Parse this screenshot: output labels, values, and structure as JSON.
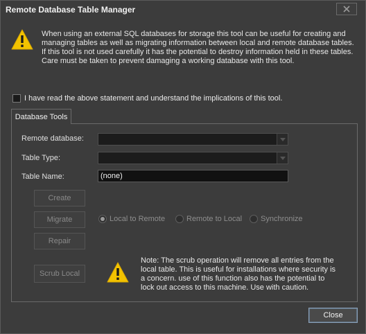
{
  "window": {
    "title": "Remote Database Table Manager",
    "close_icon": "close-icon"
  },
  "warning": {
    "text": [
      "When using an external SQL databases for storage this tool can be useful for creating and",
      "managing tables as well as migrating information between local and remote database tables.",
      "If this tool is not used carefully it has the potential to destroy information held in these tables.",
      "Care must be taken to prevent damaging a working database with this tool."
    ]
  },
  "acknowledge": {
    "label": "I have read the above statement and understand the implications of this tool.",
    "checked": false
  },
  "tabs": [
    {
      "label": "Database Tools",
      "selected": true
    }
  ],
  "form": {
    "remote_db_label": "Remote database:",
    "remote_db_value": "",
    "table_type_label": "Table Type:",
    "table_type_value": "",
    "table_name_label": "Table Name:",
    "table_name_value": "(none)"
  },
  "buttons": {
    "create": "Create",
    "migrate": "Migrate",
    "repair": "Repair",
    "scrub": "Scrub Local",
    "close": "Close"
  },
  "migrate_options": [
    {
      "label": "Local to Remote",
      "selected": true
    },
    {
      "label": "Remote to Local",
      "selected": false
    },
    {
      "label": "Synchronize",
      "selected": false
    }
  ],
  "scrub_note": {
    "text": [
      "Note: The scrub operation will remove all entries from the",
      "local table.  This is useful for installations where security is",
      "a concern.  use of this function also has the potential to",
      "lock out access to this machine.  Use with caution."
    ]
  },
  "colors": {
    "warning_yellow": "#f2c200",
    "background": "#3c3c3c",
    "field_dark": "#1c1c1c",
    "close_border": "#8aa0b8"
  }
}
